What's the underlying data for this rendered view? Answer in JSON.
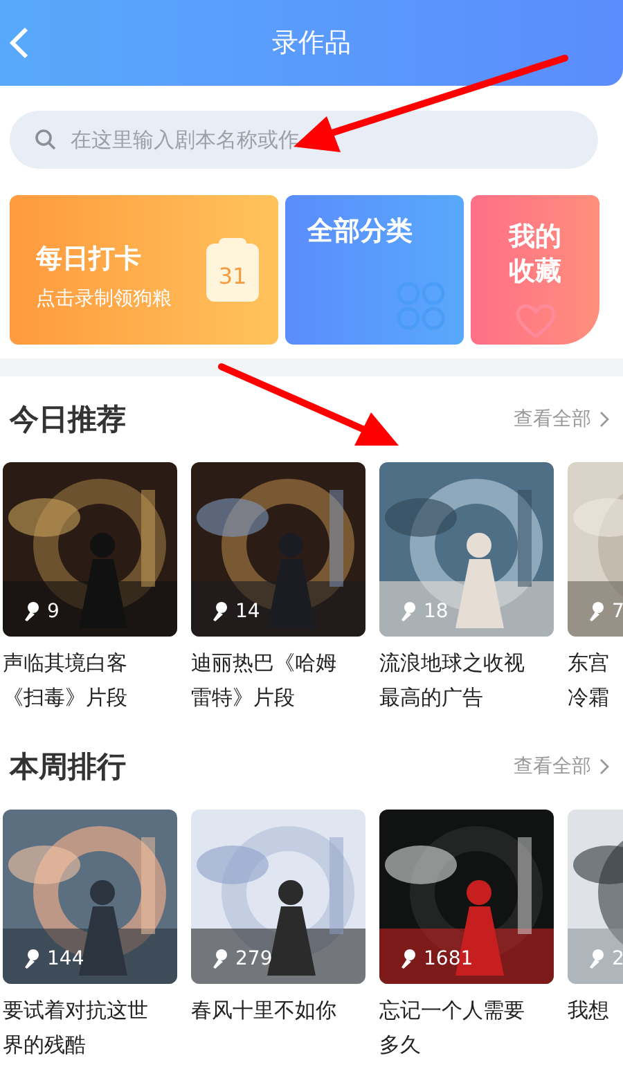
{
  "header": {
    "title": "录作品"
  },
  "search": {
    "placeholder": "在这里输入剧本名称或作"
  },
  "shortcuts": [
    {
      "kind": "checkin",
      "title": "每日打卡",
      "subtitle": "点击录制领狗粮",
      "badge": "31"
    },
    {
      "kind": "categories",
      "title": "全部分类"
    },
    {
      "kind": "favorites",
      "title": "我的收藏"
    }
  ],
  "sections": [
    {
      "title": "今日推荐",
      "more": "查看全部",
      "items": [
        {
          "count": "9",
          "title_lines": [
            "声临其境白客",
            "《扫毒》片段"
          ]
        },
        {
          "count": "14",
          "title_lines": [
            "迪丽热巴《哈姆",
            "雷特》片段"
          ]
        },
        {
          "count": "18",
          "title_lines": [
            "流浪地球之收视",
            "最高的广告"
          ]
        },
        {
          "count": "7",
          "title_lines": [
            "东宫",
            "冷霜"
          ]
        }
      ]
    },
    {
      "title": "本周排行",
      "more": "查看全部",
      "items": [
        {
          "count": "144",
          "title_lines": [
            "要试着对抗这世",
            "界的残酷"
          ]
        },
        {
          "count": "279",
          "title_lines": [
            "春风十里不如你"
          ]
        },
        {
          "count": "1681",
          "title_lines": [
            "忘记一个人需要",
            "多久"
          ]
        },
        {
          "count": "2",
          "title_lines": [
            "我想"
          ]
        }
      ]
    }
  ]
}
